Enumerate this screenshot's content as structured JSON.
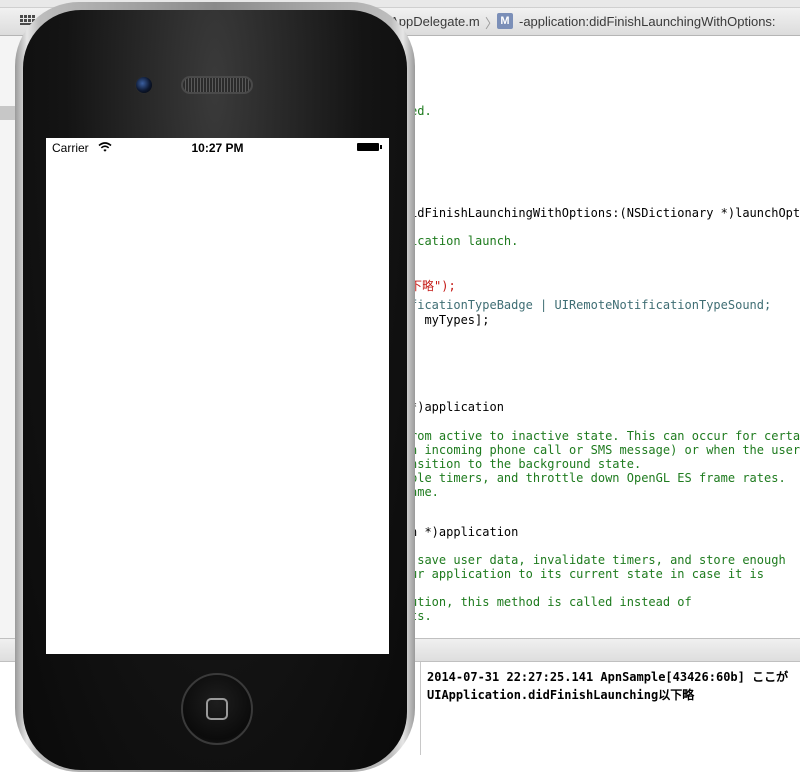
{
  "jumpbar": {
    "file": "leAppDelegate.m",
    "separator": "〉",
    "method_badge": "M",
    "method": "-application:didFinishLaunchingWithOptions:"
  },
  "code_lines": [
    {
      "text": "ed.",
      "cls": "cm"
    },
    {
      "text": "idFinishLaunchingWithOptions:(NSDictionary *)launchOptio",
      "cls": "pl"
    },
    {
      "text": "ication launch.",
      "cls": "cm"
    },
    {
      "text": "下略\");",
      "cls": "st"
    },
    {
      "text": "ficationTypeBadge | UIRemoteNotificationTypeSound;",
      "cls": "pl"
    },
    {
      "text": ": myTypes];",
      "cls": "pl"
    },
    {
      "text": "*)application",
      "cls": "pl"
    },
    {
      "text": "rom active to inactive state. This can occur for certai",
      "cls": "cm"
    },
    {
      "text": "n incoming phone call or SMS message) or when the user",
      "cls": "cm"
    },
    {
      "text": "nsition to the background state.",
      "cls": "cm"
    },
    {
      "text": "ble timers, and throttle down OpenGL ES frame rates.",
      "cls": "cm"
    },
    {
      "text": "ame.",
      "cls": "cm"
    },
    {
      "text": "n *)application",
      "cls": "pl"
    },
    {
      "text": " save user data, invalidate timers, and store enough",
      "cls": "cm"
    },
    {
      "text": "ur application to its current state in case it is",
      "cls": "cm"
    },
    {
      "text": "ution, this method is called instead of",
      "cls": "cm"
    },
    {
      "text": "ts.",
      "cls": "cm"
    }
  ],
  "console": {
    "line1": "2014-07-31 22:27:25.141 ApnSample[43426:60b] ここが",
    "line2": "UIApplication.didFinishLaunching以下略"
  },
  "simulator": {
    "carrier": "Carrier",
    "time": "10:27 PM"
  },
  "icons": [
    "related-items-icon",
    "method-icon",
    "wifi-icon",
    "battery-icon",
    "home-button-icon"
  ]
}
